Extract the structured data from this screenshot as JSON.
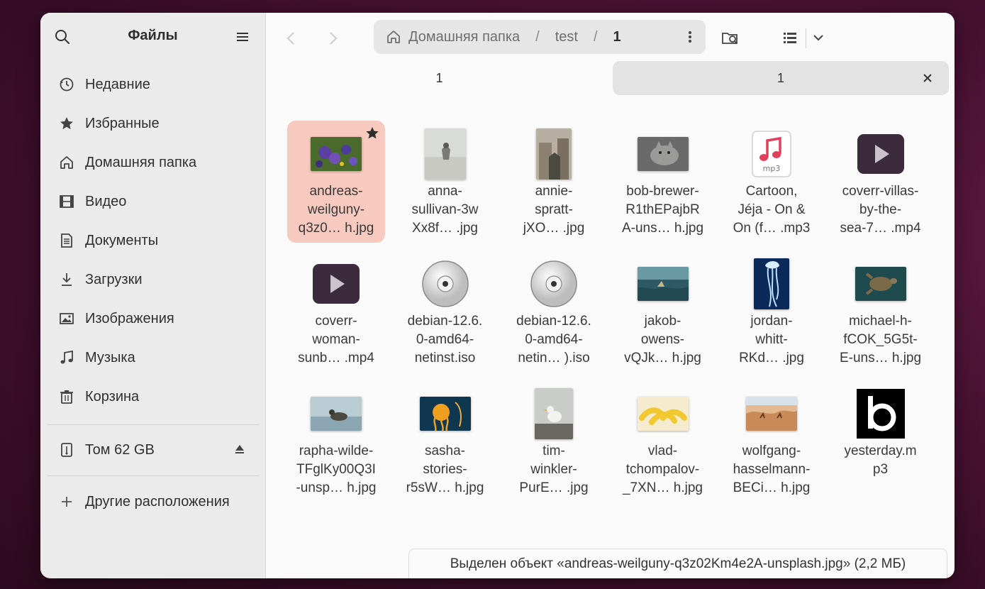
{
  "sidebar": {
    "title": "Файлы",
    "items": [
      {
        "label": "Недавние",
        "icon": "recent-icon"
      },
      {
        "label": "Избранные",
        "icon": "star-icon"
      },
      {
        "label": "Домашняя папка",
        "icon": "home-icon"
      },
      {
        "label": "Видео",
        "icon": "video-icon"
      },
      {
        "label": "Документы",
        "icon": "document-icon"
      },
      {
        "label": "Загрузки",
        "icon": "download-icon"
      },
      {
        "label": "Изображения",
        "icon": "image-icon"
      },
      {
        "label": "Музыка",
        "icon": "music-icon"
      },
      {
        "label": "Корзина",
        "icon": "trash-icon"
      }
    ],
    "volume": {
      "label": "Том 62 GB",
      "icon": "usb-drive-icon"
    },
    "other": {
      "label": "Другие расположения",
      "icon": "plus-icon"
    }
  },
  "pathbar": {
    "segments": [
      "Домашняя папка",
      "test",
      "1"
    ],
    "separator": "/"
  },
  "tabs": [
    {
      "label": "1",
      "active": false
    },
    {
      "label": "1",
      "active": true
    }
  ],
  "files": [
    {
      "name": "andreas-\nweilguny-\nq3z0… h.jpg",
      "kind": "image",
      "thumb": "flowers",
      "selected": true,
      "starred": true
    },
    {
      "name": "anna-\nsullivan-3w\nXx8f… .jpg",
      "kind": "image",
      "thumb": "beach-portrait"
    },
    {
      "name": "annie-\nspratt-\njXO… .jpg",
      "kind": "image",
      "thumb": "street-portrait"
    },
    {
      "name": "bob-brewer-\nR1thEPajbR\nA-uns… h.jpg",
      "kind": "image",
      "thumb": "gray-cat"
    },
    {
      "name": "Cartoon,\nJéja - On &\nOn (f… .mp3",
      "kind": "audio",
      "thumb": "mp3"
    },
    {
      "name": "coverr-villas-\nby-the-\nsea-7… .mp4",
      "kind": "video",
      "thumb": "video"
    },
    {
      "name": "coverr-\nwoman-\nsunb… .mp4",
      "kind": "video",
      "thumb": "video"
    },
    {
      "name": "debian-12.6.\n0-amd64-\nnetinst.iso",
      "kind": "disc",
      "thumb": "disc"
    },
    {
      "name": "debian-12.6.\n0-amd64-\nnetin… ).iso",
      "kind": "disc",
      "thumb": "disc"
    },
    {
      "name": "jakob-\nowens-\nvQJk… h.jpg",
      "kind": "image",
      "thumb": "underwater"
    },
    {
      "name": "jordan-\nwhitt-\nRKd… .jpg",
      "kind": "image",
      "thumb": "jellyfish"
    },
    {
      "name": "michael-h-\nfCOK_5G5t-\nE-uns… h.jpg",
      "kind": "image",
      "thumb": "turtle"
    },
    {
      "name": "rapha-wilde-\nTFglKy00Q3I\n-unsp… h.jpg",
      "kind": "image",
      "thumb": "duck"
    },
    {
      "name": "sasha-\nstories-\nr5sW… h.jpg",
      "kind": "image",
      "thumb": "orange-jelly"
    },
    {
      "name": "tim-\nwinkler-\nPurE… .jpg",
      "kind": "image",
      "thumb": "seagull"
    },
    {
      "name": "vlad-\ntchompalov-\n_7XN… h.jpg",
      "kind": "image",
      "thumb": "bananas"
    },
    {
      "name": "wolfgang-\nhasselmann-\nBECi… h.jpg",
      "kind": "image",
      "thumb": "desert"
    },
    {
      "name": "yesterday.m\np3",
      "kind": "audio",
      "thumb": "b-logo"
    }
  ],
  "status": "Выделен объект «andreas-weilguny-q3z02Km4e2A-unsplash.jpg» (2,2 МБ)",
  "colors": {
    "selection": "#f7c9bf",
    "sidebar_bg": "#ebebeb",
    "video_thumb": "#3b2b3d"
  }
}
